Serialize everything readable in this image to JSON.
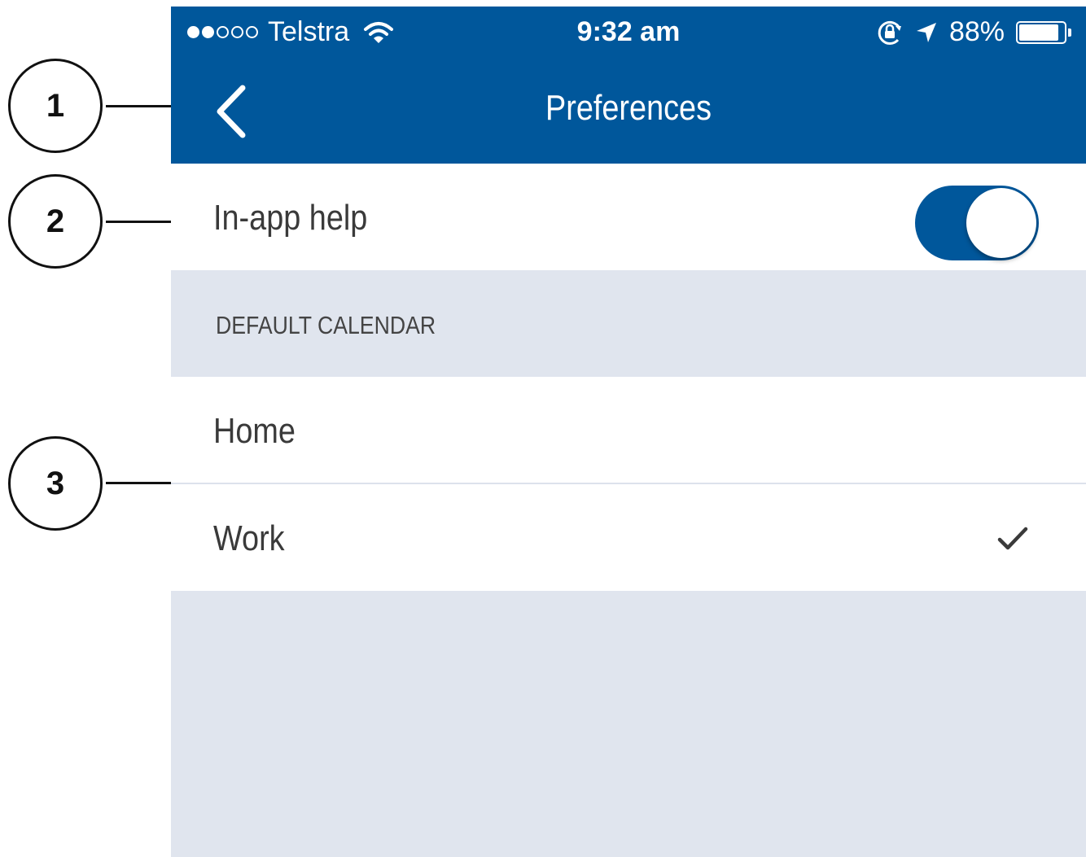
{
  "callouts": [
    "1",
    "2",
    "3"
  ],
  "status_bar": {
    "carrier": "Telstra",
    "time": "9:32 am",
    "battery": "88%",
    "signal_bars_filled": 2,
    "signal_bars_total": 5,
    "icons": [
      "wifi-icon",
      "rotation-lock-icon",
      "location-arrow-icon",
      "battery-icon"
    ]
  },
  "nav": {
    "title": "Preferences",
    "back_icon": "chevron-left-icon"
  },
  "settings": {
    "in_app_help": {
      "label": "In-app help",
      "enabled": true
    }
  },
  "default_calendar": {
    "header": "DEFAULT CALENDAR",
    "options": [
      {
        "label": "Home",
        "selected": false
      },
      {
        "label": "Work",
        "selected": true
      }
    ],
    "selected_icon": "checkmark-icon"
  },
  "colors": {
    "brand": "#00579b",
    "background": "#e0e5ee",
    "text": "#3a3a3a"
  }
}
